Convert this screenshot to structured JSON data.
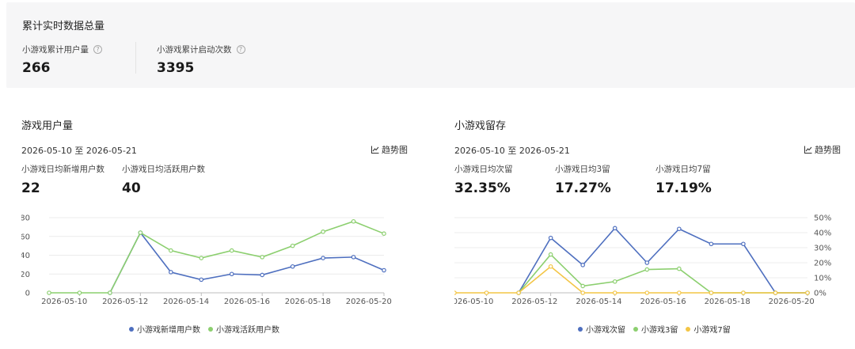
{
  "summary": {
    "title": "累计实时数据总量",
    "metrics": [
      {
        "label": "小游戏累计用户量",
        "value": "266"
      },
      {
        "label": "小游戏累计启动次数",
        "value": "3395"
      }
    ],
    "help_icon": "question-circle-icon"
  },
  "left_panel": {
    "title": "游戏用户量",
    "date_range": "2026-05-10 至 2026-05-21",
    "trend_label": "趋势图",
    "stats": [
      {
        "label": "小游戏日均新增用户数",
        "value": "22"
      },
      {
        "label": "小游戏日均活跃用户数",
        "value": "40"
      }
    ]
  },
  "right_panel": {
    "title": "小游戏留存",
    "date_range": "2026-05-10 至 2026-05-21",
    "trend_label": "趋势图",
    "stats": [
      {
        "label": "小游戏日均次留",
        "value": "32.35%"
      },
      {
        "label": "小游戏日均3留",
        "value": "17.27%"
      },
      {
        "label": "小游戏日均7留",
        "value": "17.19%"
      }
    ]
  },
  "chart_data": [
    {
      "type": "line",
      "x": [
        "2026-05-10",
        "2026-05-11",
        "2026-05-12",
        "2026-05-13",
        "2026-05-14",
        "2026-05-15",
        "2026-05-16",
        "2026-05-17",
        "2026-05-18",
        "2026-05-19",
        "2026-05-20",
        "2026-05-21"
      ],
      "xticks": [
        "2026-05-10",
        "2026-05-12",
        "2026-05-14",
        "2026-05-16",
        "2026-05-18",
        "2026-05-20"
      ],
      "yticks": [
        "0",
        "20",
        "40",
        "60",
        "80"
      ],
      "ylim": [
        0,
        80
      ],
      "series": [
        {
          "name": "小游戏新增用户数",
          "color": "#4e6fbf",
          "start": 2,
          "values": [
            0,
            0,
            0,
            64,
            22,
            14,
            20,
            19,
            28,
            37,
            38,
            24
          ]
        },
        {
          "name": "小游戏活跃用户数",
          "color": "#8ccf6f",
          "start": 0,
          "values": [
            0,
            0,
            0,
            64,
            45,
            37,
            45,
            38,
            50,
            65,
            76,
            63
          ]
        }
      ],
      "grid": true,
      "legend": "bottom"
    },
    {
      "type": "line",
      "x": [
        "2026-05-10",
        "2026-05-11",
        "2026-05-12",
        "2026-05-13",
        "2026-05-14",
        "2026-05-15",
        "2026-05-16",
        "2026-05-17",
        "2026-05-18",
        "2026-05-19",
        "2026-05-20",
        "2026-05-21"
      ],
      "xticks": [
        "2026-05-10",
        "2026-05-12",
        "2026-05-14",
        "2026-05-16",
        "2026-05-18",
        "2026-05-20"
      ],
      "yticks": [
        "0%",
        "10%",
        "20%",
        "30%",
        "40%",
        "50%"
      ],
      "ylim": [
        0,
        50
      ],
      "y_axis_side": "right",
      "series": [
        {
          "name": "小游戏次留",
          "color": "#4e6fbf",
          "start": 2,
          "values": [
            0,
            0,
            0,
            36.5,
            18.5,
            43,
            20,
            42.5,
            32.5,
            32.5,
            0,
            0
          ]
        },
        {
          "name": "小游戏3留",
          "color": "#8ccf6f",
          "start": 2,
          "values": [
            0,
            0,
            0,
            25.5,
            4.5,
            7.5,
            15.5,
            16,
            0,
            0,
            0,
            0
          ]
        },
        {
          "name": "小游戏7留",
          "color": "#f3c545",
          "start": 0,
          "values": [
            0,
            0,
            0,
            17.5,
            0,
            0,
            0,
            0,
            0,
            0,
            0,
            0
          ]
        }
      ],
      "grid": true,
      "legend": "bottom"
    }
  ]
}
